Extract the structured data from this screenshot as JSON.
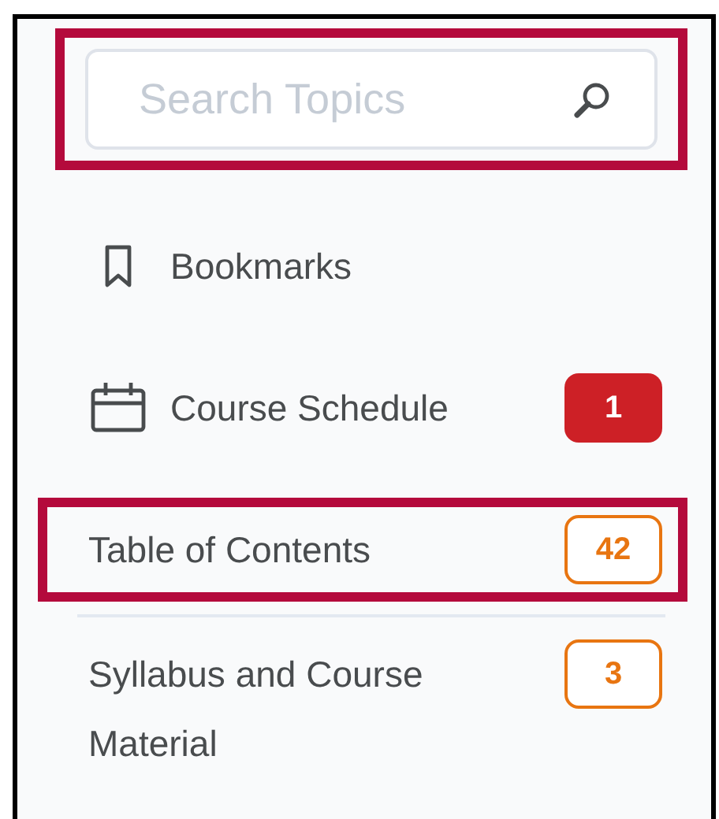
{
  "search": {
    "placeholder": "Search Topics",
    "highlighted": true
  },
  "items": [
    {
      "label": "Bookmarks",
      "kind": "bookmark",
      "highlighted": false,
      "divider_after": false
    },
    {
      "label": "Course Schedule",
      "kind": "calendar",
      "badge": {
        "text": "1",
        "kind": "solid"
      },
      "highlighted": false,
      "divider_after": false
    },
    {
      "label": "Table of Contents",
      "kind": "plain",
      "badge": {
        "text": "42",
        "kind": "outline"
      },
      "highlighted": true,
      "divider_after": true
    },
    {
      "label": "Syllabus and Course Material",
      "kind": "plain",
      "badge": {
        "text": "3",
        "kind": "outline"
      },
      "highlighted": false,
      "divider_after": false
    }
  ]
}
